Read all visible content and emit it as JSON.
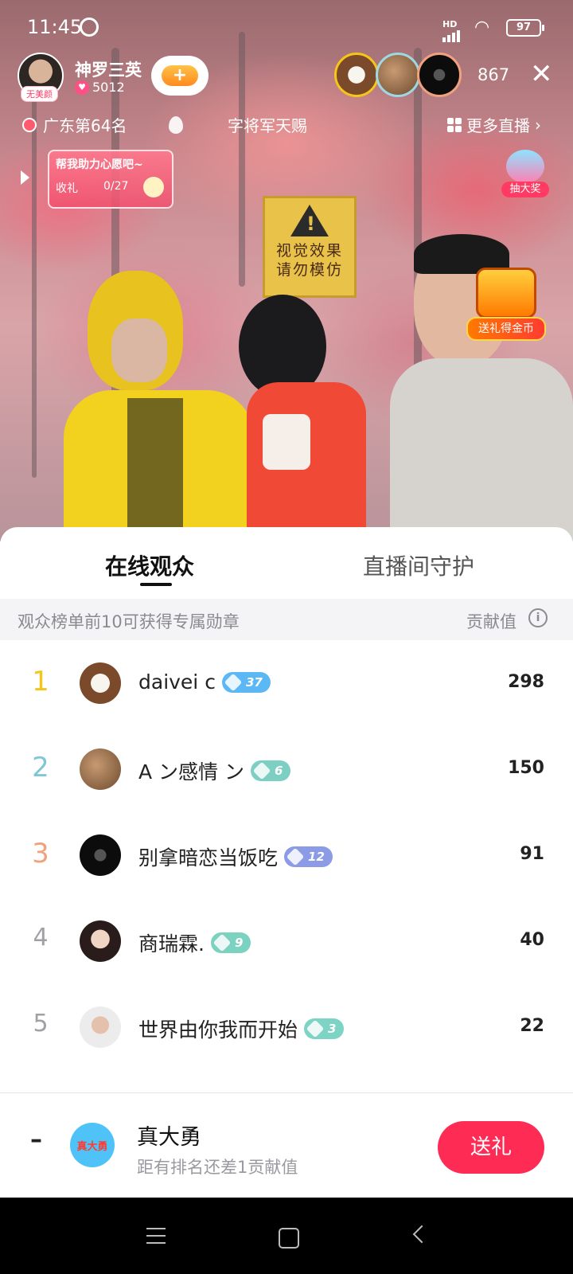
{
  "status_bar": {
    "time": "11:45",
    "network": "HD",
    "battery": "97"
  },
  "host": {
    "name": "神罗三英",
    "tag": "无美颜",
    "likes": "5012"
  },
  "viewers": {
    "count": "867"
  },
  "top_bar": {
    "rank": "广东第64名",
    "marquee": "字将军天赐",
    "more_live": "更多直播"
  },
  "wish": {
    "title": "帮我助力心愿吧~",
    "label": "收礼",
    "progress": "0/27"
  },
  "widgets": {
    "lottery": "抽大奖",
    "chest": "送礼得金币"
  },
  "stream_sign": {
    "line1": "视觉效果",
    "line2": "请勿模仿"
  },
  "sheet": {
    "tabs": [
      "在线观众",
      "直播间守护"
    ],
    "notice": "观众榜单前10可获得专属勋章",
    "contribution_label": "贡献值",
    "info_icon": "i"
  },
  "ranking": [
    {
      "rank": "1",
      "name": "daivei c",
      "level": "37",
      "score": "298",
      "rank_color": "#f5c518",
      "badge_color": "#5cb8f5"
    },
    {
      "rank": "2",
      "name": "A ン感情 ン",
      "level": "6",
      "score": "150",
      "rank_color": "#7fc6d6",
      "badge_color": "#7ccfc2"
    },
    {
      "rank": "3",
      "name": "别拿暗恋当饭吃",
      "level": "12",
      "score": "91",
      "rank_color": "#f0a27f",
      "badge_color": "#8b9be6"
    },
    {
      "rank": "4",
      "name": "商瑞霖.",
      "level": "9",
      "score": "40",
      "rank_color": "#a0a0a6",
      "badge_color": "#7cd2c0"
    },
    {
      "rank": "5",
      "name": "世界由你我而开始",
      "level": "3",
      "score": "22",
      "rank_color": "#a0a0a6",
      "badge_color": "#7dd3c4"
    }
  ],
  "self": {
    "rank": "–",
    "avatar_text": "真大勇",
    "name": "真大勇",
    "hint": "距有排名还差1贡献值",
    "gift_button": "送礼"
  },
  "colors": {
    "accent": "#fe2c55"
  }
}
